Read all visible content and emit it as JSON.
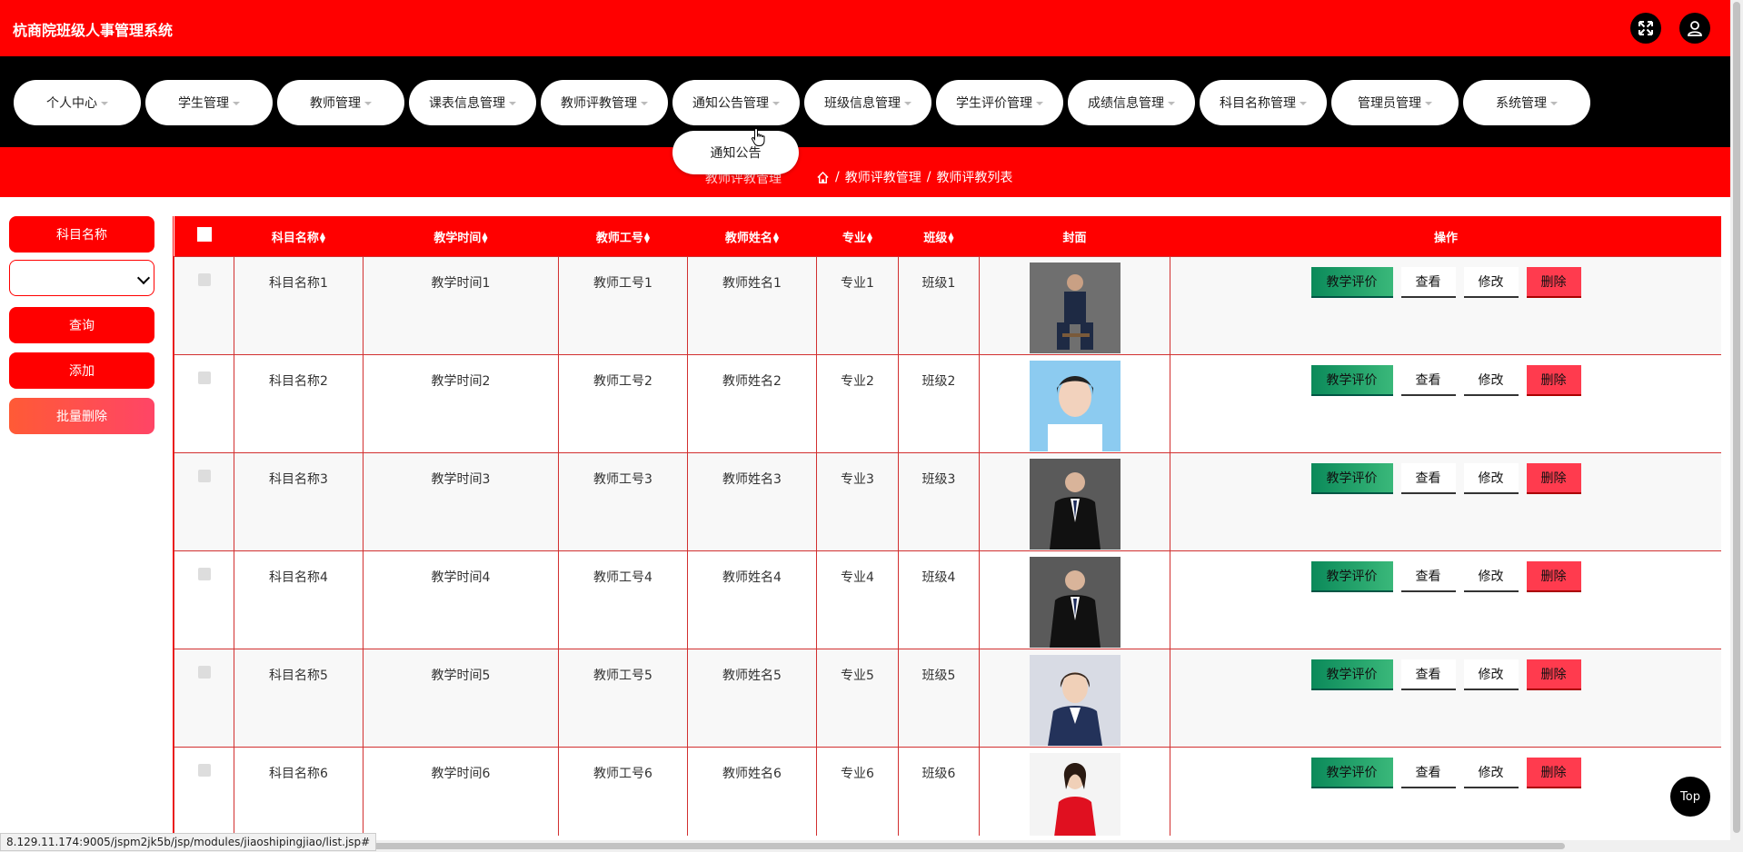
{
  "app": {
    "title": "杭商院班级人事管理系统",
    "fullscreen_icon": "fullscreen-icon",
    "user_icon": "user-icon"
  },
  "nav": {
    "items": [
      {
        "label": "个人中心"
      },
      {
        "label": "学生管理"
      },
      {
        "label": "教师管理"
      },
      {
        "label": "课表信息管理"
      },
      {
        "label": "教师评教管理"
      },
      {
        "label": "通知公告管理"
      },
      {
        "label": "班级信息管理"
      },
      {
        "label": "学生评价管理"
      },
      {
        "label": "成绩信息管理"
      },
      {
        "label": "科目名称管理"
      },
      {
        "label": "管理员管理"
      },
      {
        "label": "系统管理"
      }
    ],
    "open_dropdown": {
      "label": "通知公告"
    }
  },
  "breadcrumb": {
    "page_title": "教师评教管理",
    "trail": [
      "教师评教管理",
      "教师评教列表"
    ],
    "separator": "/"
  },
  "sidebar": {
    "filter_label": "科目名称",
    "select_value": "",
    "query_label": "查询",
    "add_label": "添加",
    "batch_delete_label": "批量删除"
  },
  "table": {
    "headers": {
      "subject": "科目名称",
      "time": "教学时间",
      "teacher_id": "教师工号",
      "teacher_name": "教师姓名",
      "major": "专业",
      "class": "班级",
      "cover": "封面",
      "actions": "操作"
    },
    "action_labels": {
      "eval": "教学评价",
      "view": "查看",
      "edit": "修改",
      "delete": "删除"
    },
    "rows": [
      {
        "subject": "科目名称1",
        "time": "教学时间1",
        "teacher_id": "教师工号1",
        "teacher_name": "教师姓名1",
        "major": "专业1",
        "class": "班级1"
      },
      {
        "subject": "科目名称2",
        "time": "教学时间2",
        "teacher_id": "教师工号2",
        "teacher_name": "教师姓名2",
        "major": "专业2",
        "class": "班级2"
      },
      {
        "subject": "科目名称3",
        "time": "教学时间3",
        "teacher_id": "教师工号3",
        "teacher_name": "教师姓名3",
        "major": "专业3",
        "class": "班级3"
      },
      {
        "subject": "科目名称4",
        "time": "教学时间4",
        "teacher_id": "教师工号4",
        "teacher_name": "教师姓名4",
        "major": "专业4",
        "class": "班级4"
      },
      {
        "subject": "科目名称5",
        "time": "教学时间5",
        "teacher_id": "教师工号5",
        "teacher_name": "教师姓名5",
        "major": "专业5",
        "class": "班级5"
      },
      {
        "subject": "科目名称6",
        "time": "教学时间6",
        "teacher_id": "教师工号6",
        "teacher_name": "教师姓名6",
        "major": "专业6",
        "class": "班级6"
      }
    ]
  },
  "status_bar": {
    "url": "8.129.11.174:9005/jspm2jk5b/jsp/modules/jiaoshipingjiao/list.jsp#"
  },
  "back_to_top": {
    "label": "Top"
  },
  "colors": {
    "primary": "#ff0000",
    "nav_bg": "#000000",
    "eval_green": "#1a9e66",
    "delete_red": "#ff3b4e"
  }
}
